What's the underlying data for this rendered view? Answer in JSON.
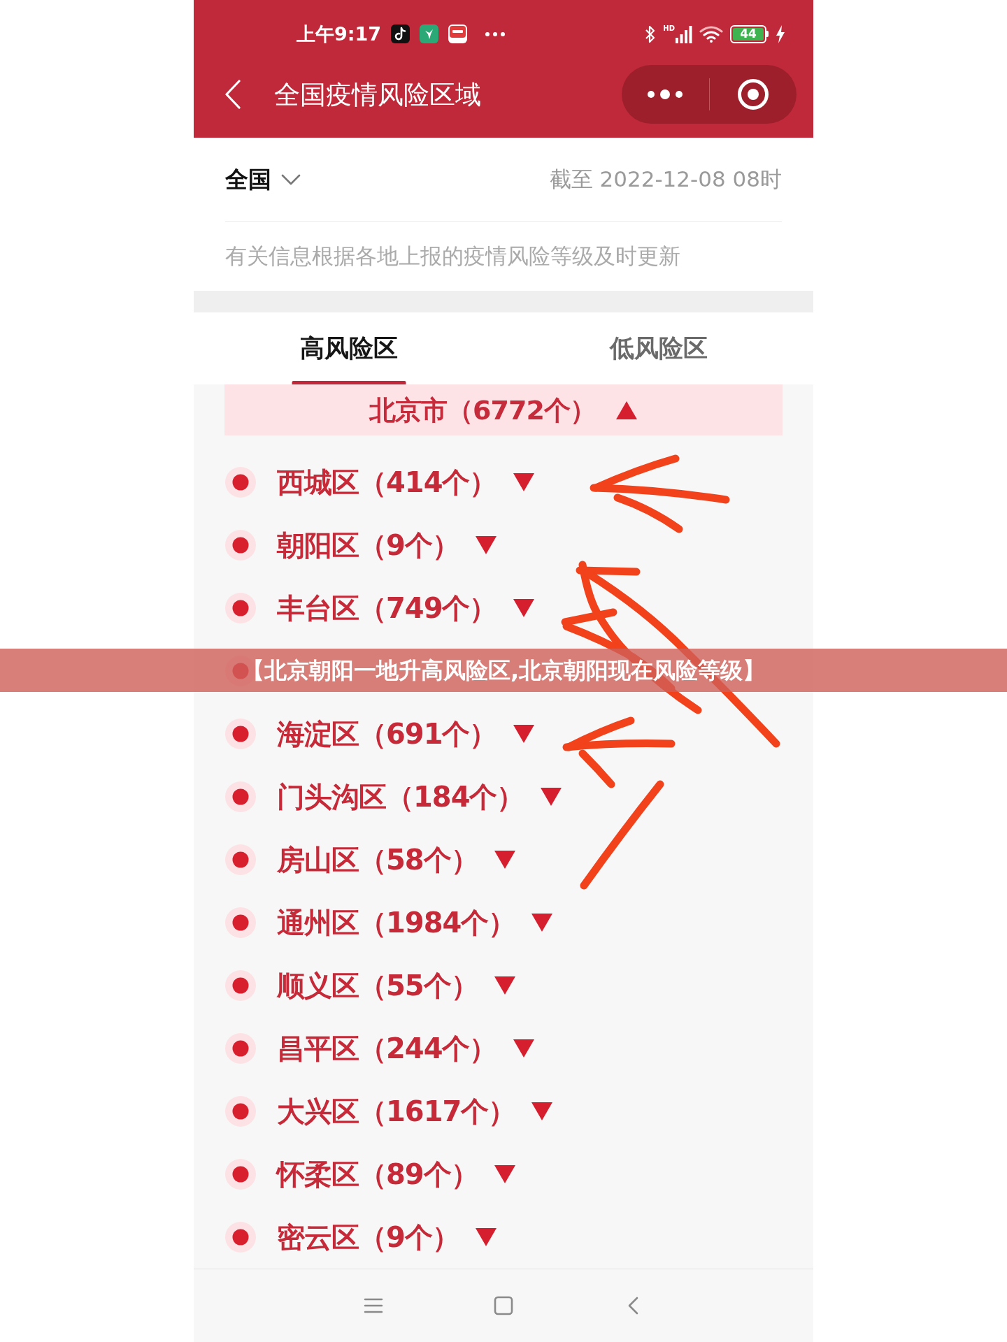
{
  "status_bar": {
    "time": "上午9:17",
    "network_badge": "HD",
    "battery": "44"
  },
  "nav_bar": {
    "title": "全国疫情风险区域"
  },
  "filter": {
    "region": "全国",
    "updated": "截至 2022-12-08 08时"
  },
  "notice": "有关信息根据各地上报的疫情风险等级及时更新",
  "tabs": [
    {
      "label": "高风险区",
      "selected": true
    },
    {
      "label": "低风险区",
      "selected": false
    }
  ],
  "city_group": {
    "title": "北京市（6772个）",
    "expanded": true
  },
  "districts": [
    {
      "kind": "district",
      "name": "西城区（414个）",
      "expanded": false
    },
    {
      "kind": "district",
      "name": "朝阳区（9个）",
      "expanded": false
    },
    {
      "kind": "district",
      "name": "丰台区（749个）",
      "expanded": false
    },
    {
      "kind": "covered"
    },
    {
      "kind": "district",
      "name": "海淀区（691个）",
      "expanded": false
    },
    {
      "kind": "district",
      "name": "门头沟区（184个）",
      "expanded": false
    },
    {
      "kind": "district",
      "name": "房山区（58个）",
      "expanded": false
    },
    {
      "kind": "district",
      "name": "通州区（1984个）",
      "expanded": false
    },
    {
      "kind": "district",
      "name": "顺义区（55个）",
      "expanded": false
    },
    {
      "kind": "district",
      "name": "昌平区（244个）",
      "expanded": false
    },
    {
      "kind": "district",
      "name": "大兴区（1617个）",
      "expanded": false
    },
    {
      "kind": "district",
      "name": "怀柔区（89个）",
      "expanded": false
    },
    {
      "kind": "district",
      "name": "密云区（9个）",
      "expanded": false
    }
  ],
  "banner": {
    "text": "【北京朝阳一地升高风险区,北京朝阳现在风险等级】"
  }
}
